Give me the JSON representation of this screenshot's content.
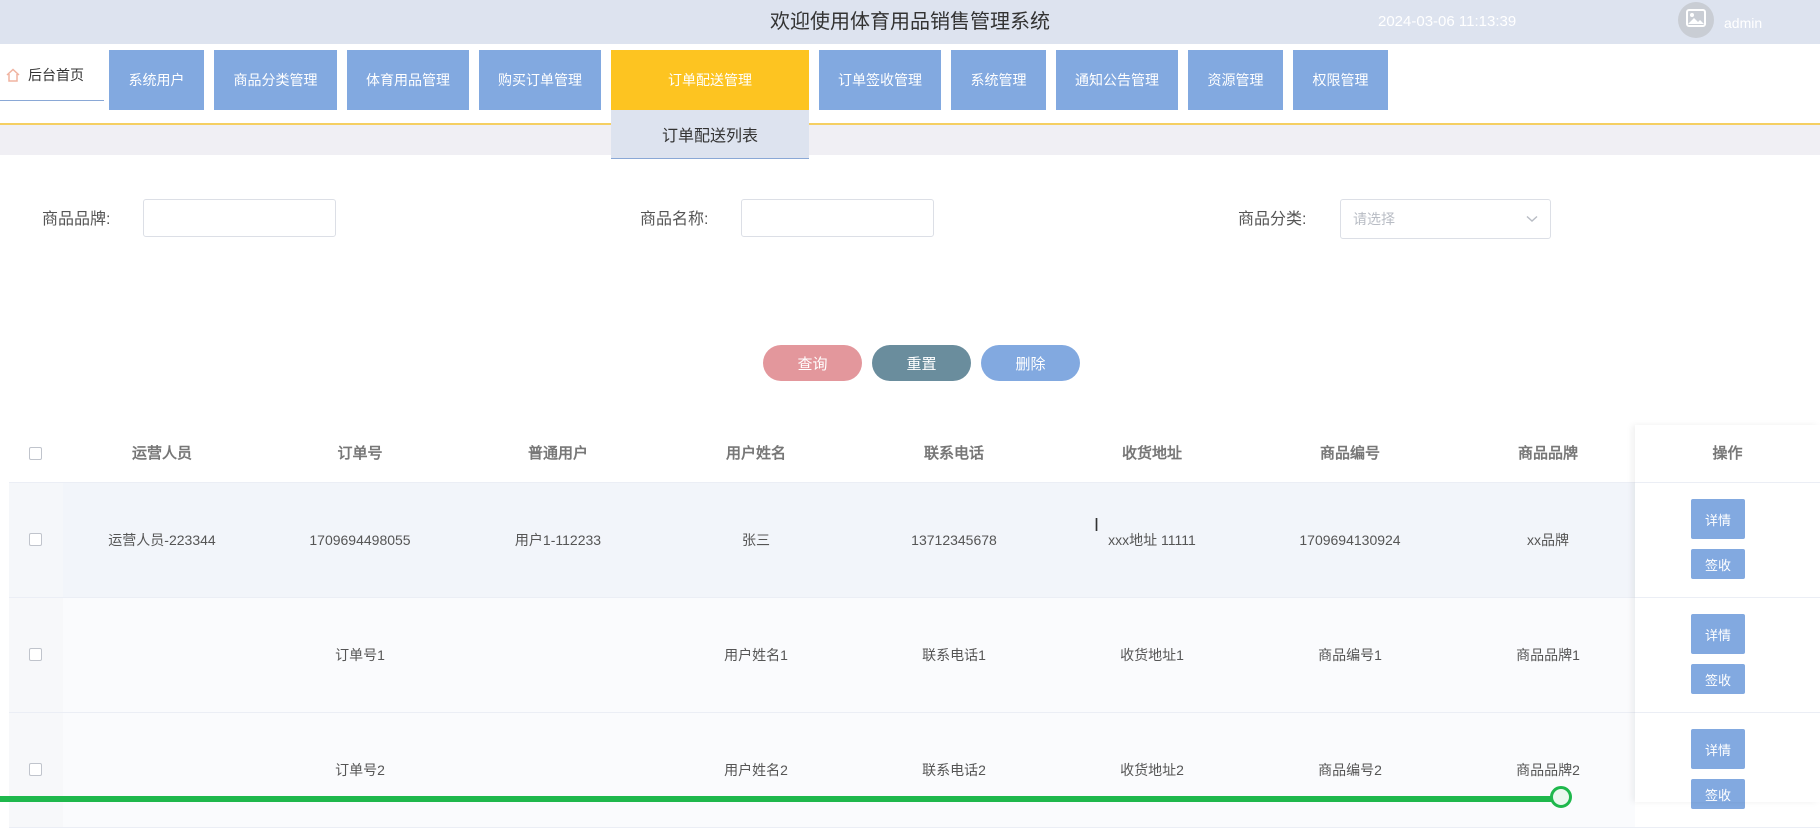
{
  "header": {
    "title": "欢迎使用体育用品销售管理系统",
    "datetime": "2024-03-06 11:13:39",
    "username": "admin"
  },
  "nav": {
    "home": "后台首页",
    "items": [
      {
        "label": "系统用户"
      },
      {
        "label": "商品分类管理"
      },
      {
        "label": "体育用品管理"
      },
      {
        "label": "购买订单管理"
      },
      {
        "label": "订单配送管理"
      },
      {
        "label": "订单签收管理"
      },
      {
        "label": "系统管理"
      },
      {
        "label": "通知公告管理"
      },
      {
        "label": "资源管理"
      },
      {
        "label": "权限管理"
      }
    ],
    "active_dropdown_item": "订单配送列表"
  },
  "search": {
    "brand_label": "商品品牌:",
    "name_label": "商品名称:",
    "category_label": "商品分类:",
    "category_placeholder": "请选择",
    "query_button": "查询",
    "reset_button": "重置",
    "delete_button": "删除"
  },
  "table": {
    "columns": [
      "运营人员",
      "订单号",
      "普通用户",
      "用户姓名",
      "联系电话",
      "收货地址",
      "商品编号",
      "商品品牌",
      "操作"
    ],
    "rows": [
      [
        "运营人员-223344",
        "1709694498055",
        "用户1-112233",
        "张三",
        "13712345678",
        "xxx地址 11111",
        "1709694130924",
        "xx品牌"
      ],
      [
        "",
        "订单号1",
        "",
        "用户姓名1",
        "联系电话1",
        "收货地址1",
        "商品编号1",
        "商品品牌1"
      ],
      [
        "",
        "订单号2",
        "",
        "用户姓名2",
        "联系电话2",
        "收货地址2",
        "商品编号2",
        "商品品牌2"
      ]
    ],
    "detail_button": "详情",
    "sign_button": "签收"
  },
  "colors": {
    "nav_item": "#82a9e0",
    "nav_active": "#fdc421",
    "query_btn": "#e3979c",
    "reset_btn": "#6a8d9d",
    "delete_btn": "#82a9e0",
    "header_bg": "#dde3ef",
    "progress": "#1eb84c"
  }
}
